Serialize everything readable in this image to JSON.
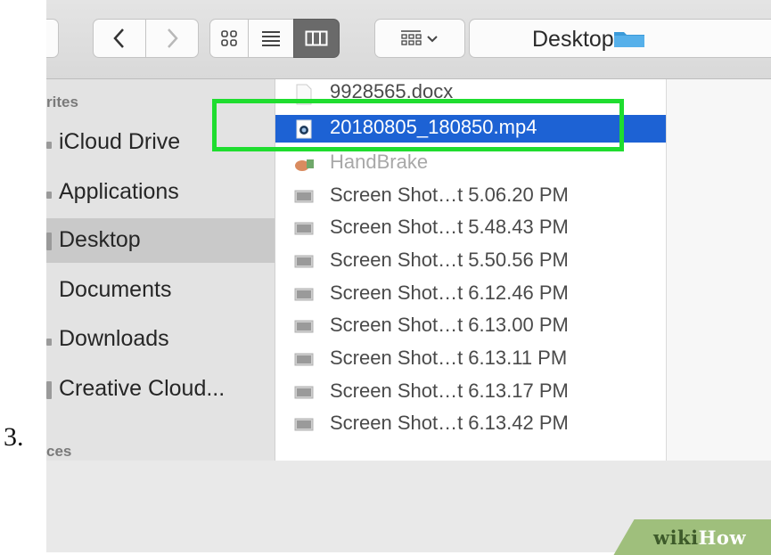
{
  "step_label": "3.",
  "toolbar": {
    "path_label": "Desktop",
    "view_modes": [
      "icons",
      "list",
      "columns"
    ],
    "active_view": "columns"
  },
  "sidebar": {
    "heading_favorites": "rites",
    "items": [
      {
        "label": "iCloud Drive"
      },
      {
        "label": "Applications"
      },
      {
        "label": "Desktop"
      },
      {
        "label": "Documents"
      },
      {
        "label": "Downloads"
      },
      {
        "label": "Creative Cloud..."
      }
    ],
    "heading_devices": "ces",
    "selected": "Desktop"
  },
  "files": [
    {
      "name": "9928565.docx",
      "icon": "document-icon",
      "faded": false
    },
    {
      "name": "20180805_180850.mp4",
      "icon": "quicktime-video-icon",
      "selected": true
    },
    {
      "name": "HandBrake",
      "icon": "handbrake-app-icon",
      "faded": true
    },
    {
      "name": "Screen Shot…t 5.06.20 PM",
      "icon": "screenshot-icon"
    },
    {
      "name": "Screen Shot…t 5.48.43 PM",
      "icon": "screenshot-icon"
    },
    {
      "name": "Screen Shot…t 5.50.56 PM",
      "icon": "screenshot-icon"
    },
    {
      "name": "Screen Shot…t 6.12.46 PM",
      "icon": "screenshot-icon"
    },
    {
      "name": "Screen Shot…t 6.13.00 PM",
      "icon": "screenshot-icon"
    },
    {
      "name": "Screen Shot…t 6.13.11 PM",
      "icon": "screenshot-icon"
    },
    {
      "name": "Screen Shot…t 6.13.17 PM",
      "icon": "screenshot-icon"
    },
    {
      "name": "Screen Shot…t 6.13.42 PM",
      "icon": "screenshot-icon"
    }
  ],
  "watermark": {
    "prefix": "wiki",
    "suffix": "How"
  },
  "colors": {
    "selection": "#1d62d4",
    "highlight": "#1fdd2f",
    "folder": "#3a9ad9"
  }
}
